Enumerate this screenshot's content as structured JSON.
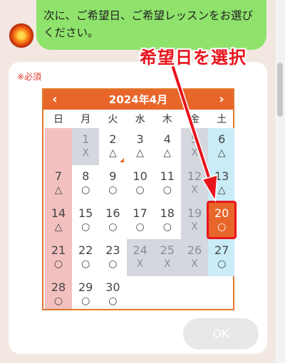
{
  "message": {
    "text": "次に、ご希望日、ご希望レッスンをお選びください。"
  },
  "form": {
    "required_label": "※必須",
    "ok_label": "OK"
  },
  "calendar": {
    "title": "2024年4月",
    "prev_icon": "‹",
    "next_icon": "›",
    "weekdays": [
      "日",
      "月",
      "火",
      "水",
      "木",
      "金",
      "土"
    ],
    "colors": {
      "header": "#e8662a",
      "sunday": "#f3c0c0",
      "saturday": "#c9ecf7",
      "unavailable": "#d4d7dd",
      "selected": "#e8662a"
    },
    "days": [
      {
        "d": "1",
        "m": "X",
        "status": "unavailable"
      },
      {
        "d": "2",
        "m": "△",
        "status": "few",
        "flag": "orange-corner"
      },
      {
        "d": "3",
        "m": "△",
        "status": "few"
      },
      {
        "d": "4",
        "m": "△",
        "status": "few"
      },
      {
        "d": "5",
        "m": "X",
        "status": "unavailable"
      },
      {
        "d": "6",
        "m": "△",
        "status": "few"
      },
      {
        "d": "7",
        "m": "△",
        "status": "few"
      },
      {
        "d": "8",
        "m": "○",
        "status": "available"
      },
      {
        "d": "9",
        "m": "○",
        "status": "available"
      },
      {
        "d": "10",
        "m": "○",
        "status": "available"
      },
      {
        "d": "11",
        "m": "○",
        "status": "available"
      },
      {
        "d": "12",
        "m": "X",
        "status": "unavailable"
      },
      {
        "d": "13",
        "m": "△",
        "status": "few"
      },
      {
        "d": "14",
        "m": "△",
        "status": "few"
      },
      {
        "d": "15",
        "m": "○",
        "status": "available"
      },
      {
        "d": "16",
        "m": "○",
        "status": "available"
      },
      {
        "d": "17",
        "m": "○",
        "status": "available"
      },
      {
        "d": "18",
        "m": "○",
        "status": "available"
      },
      {
        "d": "19",
        "m": "X",
        "status": "unavailable"
      },
      {
        "d": "20",
        "m": "○",
        "status": "selected"
      },
      {
        "d": "21",
        "m": "○",
        "status": "available"
      },
      {
        "d": "22",
        "m": "○",
        "status": "available"
      },
      {
        "d": "23",
        "m": "○",
        "status": "available"
      },
      {
        "d": "24",
        "m": "X",
        "status": "unavailable"
      },
      {
        "d": "25",
        "m": "X",
        "status": "unavailable"
      },
      {
        "d": "26",
        "m": "X",
        "status": "unavailable"
      },
      {
        "d": "27",
        "m": "○",
        "status": "available"
      },
      {
        "d": "28",
        "m": "○",
        "status": "available"
      },
      {
        "d": "29",
        "m": "○",
        "status": "available"
      },
      {
        "d": "30",
        "m": "○",
        "status": "available"
      }
    ]
  },
  "annotation": {
    "text": "希望日を選択",
    "color": "#e8141c"
  }
}
